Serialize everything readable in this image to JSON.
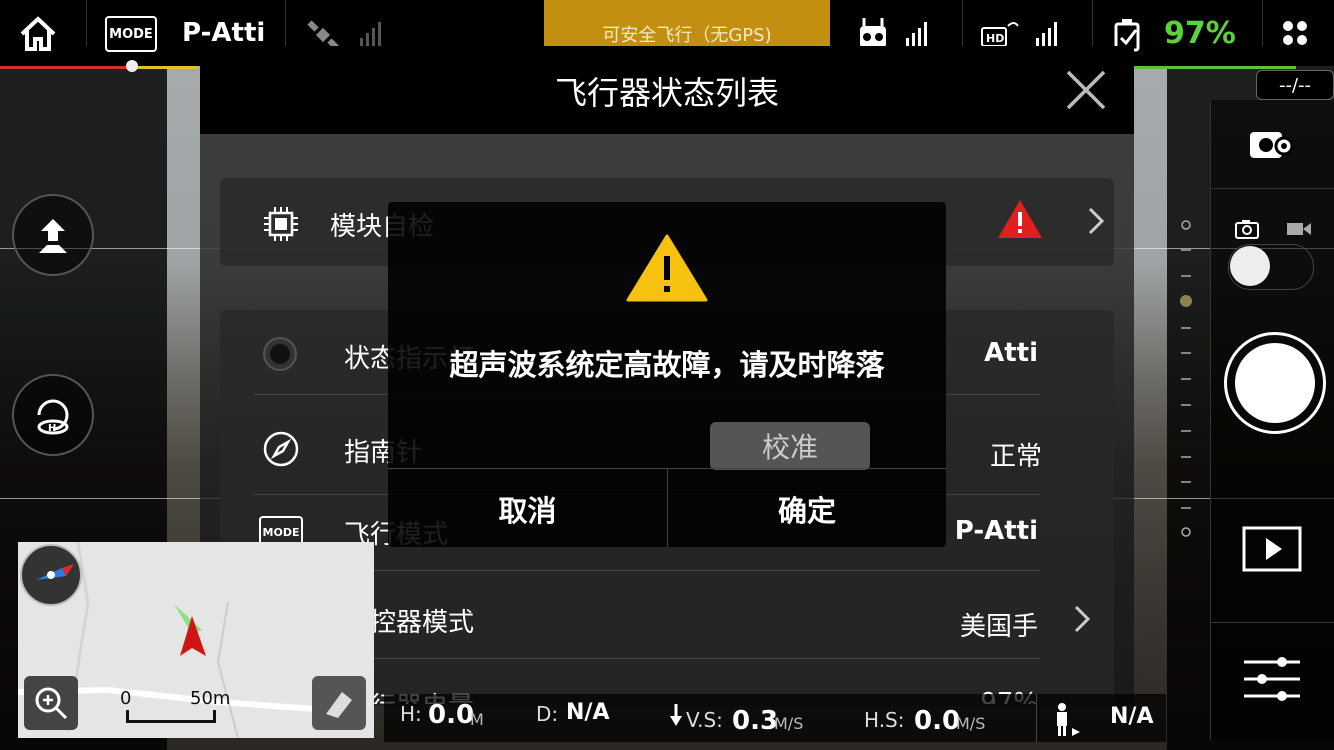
{
  "topbar": {
    "mode_badge": "MODE",
    "flight_mode": "P-Atti",
    "gps_status": "可安全飞行（无GPS)",
    "battery_percent": "97%",
    "battery_color": "#5bd23a",
    "gimbal_readout": "--/--"
  },
  "modal": {
    "title": "飞行器状态列表",
    "rows": [
      {
        "label": "模块自检",
        "icon": "chip-icon",
        "value": "",
        "warning": true
      },
      {
        "label": "状态指示灯",
        "icon": "status-light-icon",
        "value": "Atti"
      },
      {
        "label": "指南针",
        "icon": "compass-icon",
        "value": "正常"
      },
      {
        "label": "飞行模式",
        "icon": "mode-icon",
        "value": "P-Atti"
      },
      {
        "label": "遥控器模式",
        "icon": "remote-controller-icon",
        "value": "美国手"
      },
      {
        "label": "飞行器电量",
        "icon": "battery-icon",
        "value": "97%"
      }
    ],
    "mode_icon_text": "MODE"
  },
  "alert": {
    "message": "超声波系统定高故障，请及时降落",
    "calibrate": "校准",
    "cancel": "取消",
    "confirm": "确定",
    "warning_color": "#f7c20f"
  },
  "telemetry": {
    "h_label": "H:",
    "h_value": "0.0",
    "h_unit": "M",
    "d_label": "D:",
    "d_value": "N/A",
    "vs_label": "V.S:",
    "vs_value": "0.3",
    "vs_unit": "M/S",
    "hs_label": "H.S:",
    "hs_value": "0.0",
    "hs_unit": "M/S",
    "person_value": "N/A"
  },
  "minimap": {
    "scale_start": "0",
    "scale_end": "50m"
  },
  "colors": {
    "gps_banner": "#c48f10",
    "warning_red": "#e0201c"
  }
}
